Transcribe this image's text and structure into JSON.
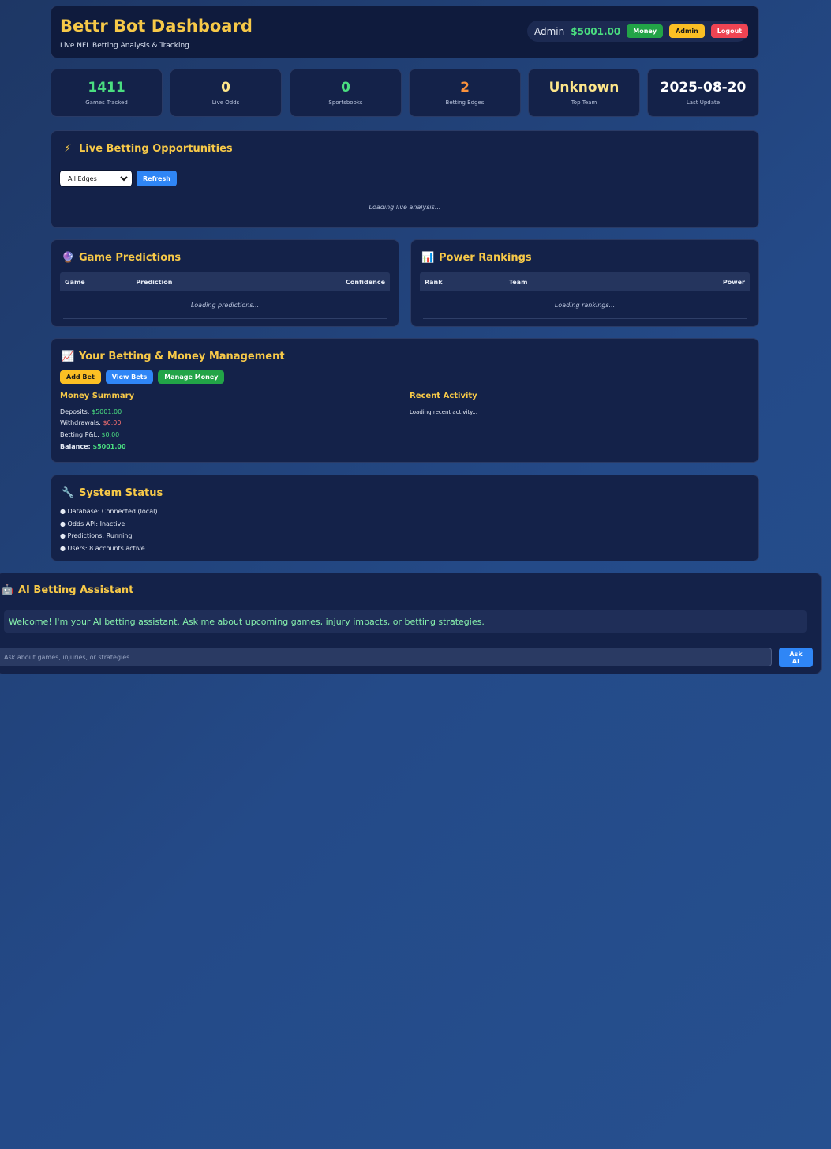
{
  "header": {
    "title": "Bettr Bot Dashboard",
    "subtitle": "Live NFL Betting Analysis & Tracking",
    "user": "Admin",
    "balance": "$5001.00",
    "money_label": "Money",
    "admin_label": "Admin",
    "logout_label": "Logout"
  },
  "stats": [
    {
      "value": "1411",
      "label": "Games Tracked",
      "color": "#4ade80"
    },
    {
      "value": "0",
      "label": "Live Odds",
      "color": "#fde68a"
    },
    {
      "value": "0",
      "label": "Sportsbooks",
      "color": "#4ade80"
    },
    {
      "value": "2",
      "label": "Betting Edges",
      "color": "#fb923c"
    },
    {
      "value": "Unknown",
      "label": "Top Team",
      "color": "#fde68a"
    },
    {
      "value": "2025-08-20",
      "label": "Last Update",
      "color": "#ffffff"
    }
  ],
  "live": {
    "title": "Live Betting Opportunities",
    "icon": "lightning-icon",
    "select_value": "All Edges",
    "refresh_label": "Refresh",
    "loading": "Loading live analysis..."
  },
  "predictions": {
    "title": "Game Predictions",
    "icon": "crystal-ball-icon",
    "columns": [
      "Game",
      "Prediction",
      "Confidence"
    ],
    "loading": "Loading predictions..."
  },
  "rankings": {
    "title": "Power Rankings",
    "icon": "bar-chart-icon",
    "columns": [
      "Rank",
      "Team",
      "Power"
    ],
    "loading": "Loading rankings..."
  },
  "money": {
    "title": "Your Betting & Money Management",
    "icon": "trend-chart-icon",
    "add_bet": "Add Bet",
    "view_bets": "View Bets",
    "manage_money": "Manage Money",
    "summary_title": "Money Summary",
    "deposits_label": "Deposits:",
    "deposits_value": "$5001.00",
    "withdrawals_label": "Withdrawals:",
    "withdrawals_value": "$0.00",
    "pl_label": "Betting P&L:",
    "pl_value": "$0.00",
    "balance_label": "Balance:",
    "balance_value": "$5001.00",
    "activity_title": "Recent Activity",
    "activity_loading": "Loading recent activity..."
  },
  "system": {
    "title": "System Status",
    "icon": "wrench-icon",
    "lines": [
      "● Database: Connected (local)",
      "● Odds API: Inactive",
      "● Predictions: Running",
      "● Users: 8 accounts active"
    ]
  },
  "ai": {
    "title": "AI Betting Assistant",
    "icon": "robot-icon",
    "welcome": "Welcome! I'm your AI betting assistant. Ask me about upcoming games, injury impacts, or betting strategies.",
    "placeholder": "Ask about games, injuries, or strategies...",
    "ask_label": "Ask AI"
  }
}
